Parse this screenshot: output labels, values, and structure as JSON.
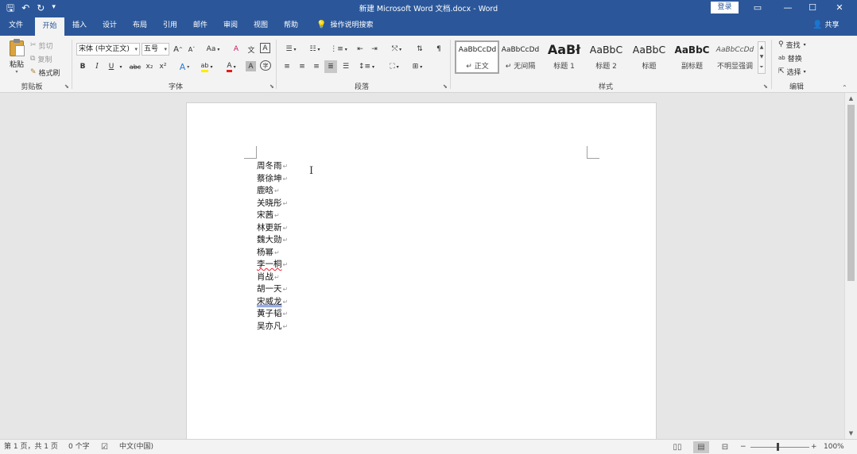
{
  "window": {
    "title": "新建 Microsoft Word 文档.docx  -  Word",
    "login": "登录",
    "controls": [
      "▭",
      "—",
      "☐",
      "✕"
    ]
  },
  "qat": {
    "save": "🖫",
    "undo": "↶",
    "redo": "↻",
    "customize": "▾"
  },
  "tabs": [
    "文件",
    "开始",
    "插入",
    "设计",
    "布局",
    "引用",
    "邮件",
    "审阅",
    "视图",
    "帮助"
  ],
  "active_tab": "开始",
  "tell_me": {
    "icon": "💡",
    "label": "操作说明搜索"
  },
  "share": {
    "icon": "👤",
    "label": "共享"
  },
  "clipboard": {
    "paste": "粘贴",
    "cut": "剪切",
    "copy": "复制",
    "format_painter": "格式刷",
    "group_label": "剪贴板"
  },
  "font": {
    "font_name": "宋体 (中文正文)",
    "font_size": "五号",
    "group_label": "字体",
    "buttons": [
      "B",
      "I",
      "U",
      "abc",
      "x₂",
      "x²"
    ],
    "grow": "A",
    "shrink": "A",
    "case": "Aa",
    "clear": "A",
    "pinyin": "文",
    "border": "A",
    "effects": "A",
    "highlight": "ab",
    "color": "A",
    "shade": "A",
    "enclose": "字"
  },
  "paragraph": {
    "group_label": "段落"
  },
  "styles": {
    "group_label": "样式",
    "items": [
      {
        "sample": "AaBbCcDd",
        "name": "↵ 正文"
      },
      {
        "sample": "AaBbCcDd",
        "name": "↵ 无间隔"
      },
      {
        "sample": "AaBł",
        "name": "标题 1"
      },
      {
        "sample": "AaBbC",
        "name": "标题 2"
      },
      {
        "sample": "AaBbC",
        "name": "标题"
      },
      {
        "sample": "AaBbC",
        "name": "副标题"
      },
      {
        "sample": "AaBbCcDd",
        "name": "不明显强调"
      }
    ]
  },
  "editing": {
    "group_label": "编辑",
    "find": "查找",
    "replace": "替换",
    "select": "选择"
  },
  "document": {
    "lines": [
      "周冬雨",
      "蔡徐坤",
      "鹿晗",
      "关晓彤",
      "宋茜",
      "林更新",
      "魏大勋",
      "杨幂",
      "李一桐",
      "肖战",
      "胡一天",
      "宋威龙",
      "黄子韬",
      "吴亦凡"
    ],
    "paragraph_mark": "↵"
  },
  "status": {
    "page": "第 1 页，共 1 页",
    "words": "0 个字",
    "language": "中文(中国)",
    "zoom": "100%",
    "zoom_minus": "−",
    "zoom_plus": "+"
  }
}
